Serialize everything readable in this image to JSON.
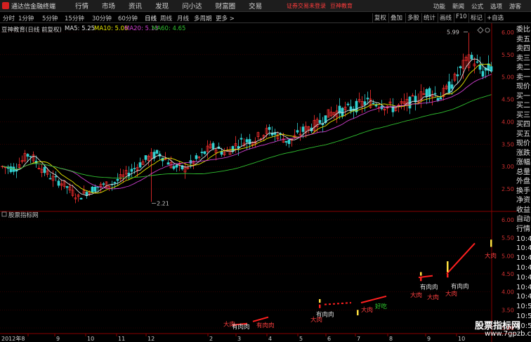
{
  "app": {
    "title": "通达信金融终端",
    "menu": [
      "行情",
      "市场",
      "资讯",
      "发现",
      "问小达",
      "财富圈",
      "交易"
    ],
    "notice_login": "证券交易未登录",
    "notice_brand": "豆神教育",
    "right_menu": [
      "功能",
      "新闻",
      "公式",
      "选项",
      "游客"
    ]
  },
  "period_toolbar": {
    "tabs": [
      "分时",
      "1分钟",
      "5分钟",
      "15分钟",
      "30分钟",
      "60分钟",
      "日线",
      "周线",
      "月线",
      "多周期",
      "更多 >"
    ],
    "active": "日线",
    "right_tools": [
      "复权",
      "叠加",
      "多股",
      "统计",
      "画线",
      "F10",
      "标记",
      "+自选"
    ]
  },
  "main_chart": {
    "stock_label": "豆神教育(日线 前复权)",
    "ma": [
      {
        "label": "MA5: 5.25",
        "color": "#e0e0e0"
      },
      {
        "label": "MA10: 5.06",
        "color": "#e8e800"
      },
      {
        "label": "MA20: 5.13",
        "color": "#d040d0"
      },
      {
        "label": "MA60: 4.65",
        "color": "#30c030"
      }
    ],
    "max_label": "5.99",
    "min_label": "2.21",
    "y_ticks": [
      "6.00",
      "5.50",
      "5.00",
      "4.50",
      "4.00",
      "3.50",
      "3.00",
      "2.50"
    ]
  },
  "indicator_panel": {
    "title": "股票指标网",
    "y_ticks": [
      "6.00",
      "5.50",
      "5.00",
      "4.50",
      "4.00",
      "3.50",
      "3.00"
    ],
    "signals": [
      "大肉",
      "有肉肉",
      "有肉肉",
      "大肉",
      "有肉肉",
      "大肉",
      "好吃",
      "大肉",
      "有肉肉",
      "大肉",
      "大肉",
      "有肉肉",
      "大肉"
    ]
  },
  "x_axis": {
    "labels": [
      "2012年8",
      "9",
      "10",
      "11",
      "12",
      "2",
      "3",
      "4",
      "5",
      "6",
      "7",
      "8",
      "9",
      "10"
    ]
  },
  "side_quote_labels": [
    "委比",
    "卖五",
    "卖四",
    "卖三",
    "卖二",
    "卖一",
    "现价",
    "买一",
    "买二",
    "买三",
    "买四",
    "买五",
    "现价",
    "涨跌",
    "涨幅",
    "总量",
    "外盘",
    "换手",
    "净资",
    "收益"
  ],
  "side_auto_labels": [
    "自动",
    "行情",
    "10:4",
    "10:4",
    "10:4",
    "10:4",
    "10:4",
    "10:4",
    "10:4",
    "10:5",
    "10:5",
    "10:5"
  ],
  "watermark": {
    "text": "股票指标网",
    "url": "www.7gpzb.com"
  },
  "colors": {
    "up": "#ff3030",
    "down": "#30d0d0",
    "ma5": "#e0e0e0",
    "ma10": "#e8e800",
    "ma20": "#d040d0",
    "ma60": "#30c030",
    "grid": "#4a0000",
    "axis_text": "#d03030"
  }
}
